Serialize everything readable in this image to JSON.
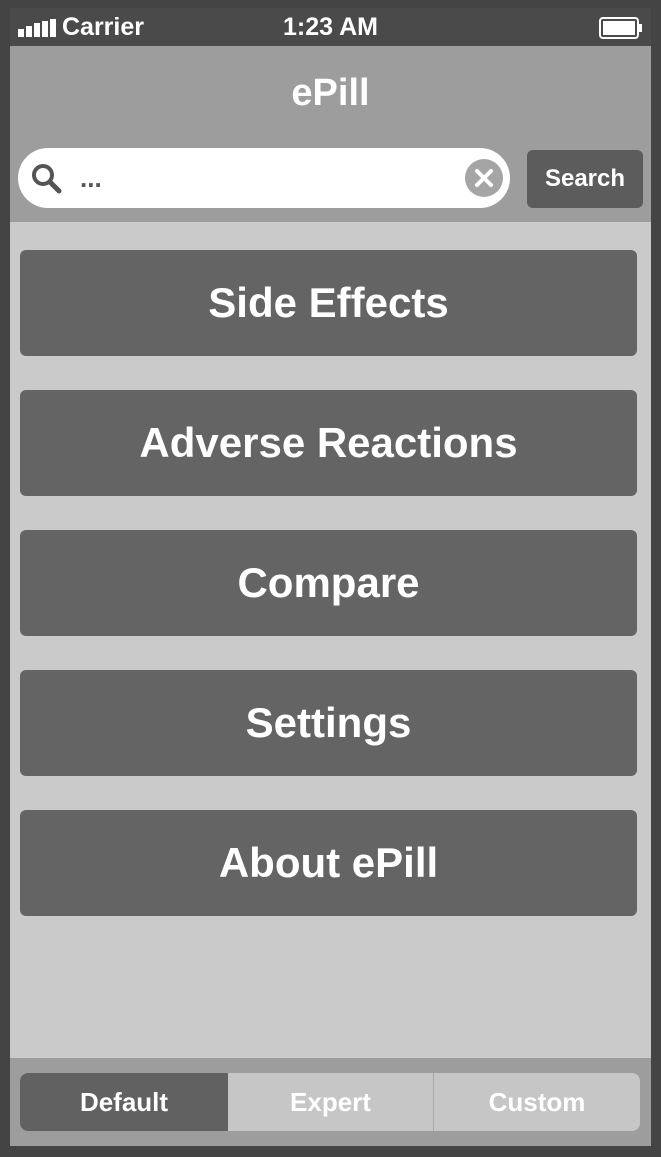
{
  "status_bar": {
    "carrier": "Carrier",
    "time": "1:23 AM",
    "signal_icon": "signal-bars-icon",
    "battery_icon": "battery-full-icon"
  },
  "nav": {
    "title": "ePill"
  },
  "search": {
    "value": "...",
    "button_label": "Search",
    "search_icon": "magnifier-icon",
    "clear_icon": "clear-x-icon"
  },
  "menu": {
    "items": [
      {
        "label": "Side Effects"
      },
      {
        "label": "Adverse Reactions"
      },
      {
        "label": "Compare"
      },
      {
        "label": "Settings"
      },
      {
        "label": "About ePill"
      }
    ]
  },
  "segments": {
    "items": [
      {
        "label": "Default"
      },
      {
        "label": "Expert"
      },
      {
        "label": "Custom"
      }
    ],
    "selected": "Default"
  },
  "colors": {
    "frame": "#444444",
    "status_bar": "#4a4a4a",
    "nav_bar": "#9d9d9d",
    "background": "#cacaca",
    "button": "#646464",
    "selected_segment": "#616161",
    "text": "#ffffff"
  }
}
